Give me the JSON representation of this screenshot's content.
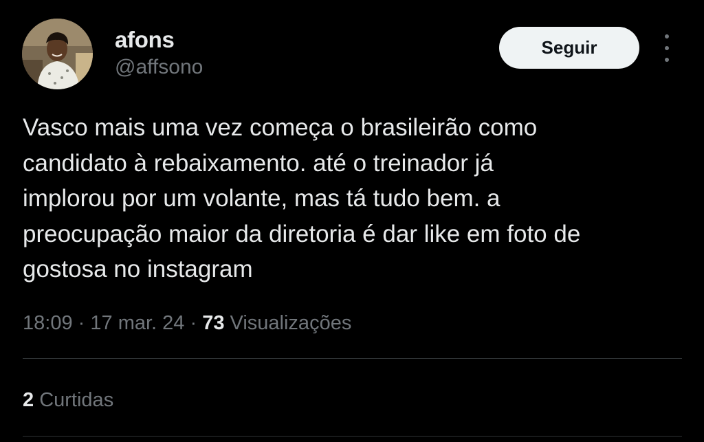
{
  "author": {
    "display_name": "afons",
    "handle": "@affsono"
  },
  "actions": {
    "follow_label": "Seguir",
    "more_icon": "more-vertical-icon"
  },
  "tweet": {
    "text": "Vasco mais uma vez começa o brasileirão como\ncandidato à rebaixamento. até o treinador já\nimplorou por um volante, mas tá tudo bem. a\npreocupação maior da diretoria é dar like em foto de\ngostosa no instagram",
    "time": "18:09",
    "date": "17 mar. 24",
    "separator": "·",
    "views_count": "73",
    "views_label": "Visualizações"
  },
  "engagement": {
    "likes_count": "2",
    "likes_label": "Curtidas"
  },
  "colors": {
    "background": "#000000",
    "primary_text": "#e7e9ea",
    "secondary_text": "#71767b",
    "button_bg": "#eff3f4",
    "divider": "#2f3336"
  }
}
